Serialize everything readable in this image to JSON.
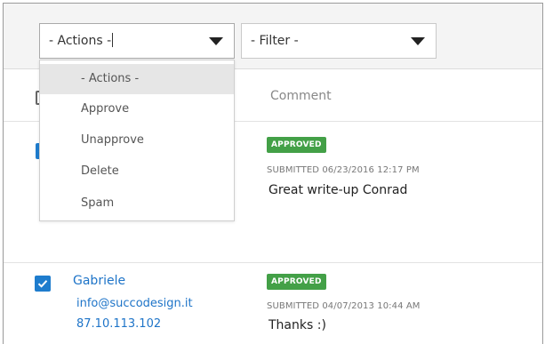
{
  "toolbar": {
    "actions_select": {
      "value": "- Actions -"
    },
    "filter_select": {
      "value": "- Filter -"
    }
  },
  "actions_menu": {
    "options": [
      {
        "label": "- Actions -",
        "selected": true
      },
      {
        "label": "Approve",
        "selected": false
      },
      {
        "label": "Unapprove",
        "selected": false
      },
      {
        "label": "Delete",
        "selected": false
      },
      {
        "label": "Spam",
        "selected": false
      }
    ]
  },
  "table": {
    "header": {
      "comment": "Comment"
    },
    "rows": [
      {
        "checked": true,
        "status": "APPROVED",
        "submitted": "SUBMITTED 06/23/2016 12:17 PM",
        "comment": "Great write-up Conrad"
      },
      {
        "checked": true,
        "author": "Gabriele",
        "email": "info@succodesign.it",
        "ip": "87.10.113.102",
        "status": "APPROVED",
        "submitted": "SUBMITTED 04/07/2013 10:44 AM",
        "comment": "Thanks :)"
      }
    ]
  },
  "colors": {
    "accent": "#1e7ccd",
    "link": "#1e74c8",
    "approved_badge": "#43a047"
  }
}
